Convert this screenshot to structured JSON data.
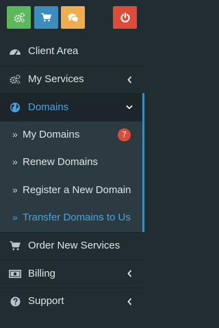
{
  "toolbar": {
    "buttons": [
      {
        "icon": "gears-icon",
        "color": "#5cb85c"
      },
      {
        "icon": "cart-icon",
        "color": "#3c8dbc"
      },
      {
        "icon": "comments-icon",
        "color": "#f0ad4e"
      },
      {
        "icon": "power-icon",
        "color": "#dd4b39"
      }
    ]
  },
  "menu": {
    "client_area": "Client Area",
    "my_services": "My Services",
    "domains": "Domains",
    "domains_sub": {
      "my_domains": "My Domains",
      "my_domains_badge": "7",
      "renew_domains": "Renew Domains",
      "register_domain": "Register a New Domain",
      "transfer_domains": "Transfer Domains to Us"
    },
    "order_services": "Order New Services",
    "billing": "Billing",
    "support": "Support"
  },
  "colors": {
    "sidebar_bg": "#222d32",
    "submenu_bg": "#2c3b41",
    "accent": "#4aa3df",
    "badge": "#dd4b39"
  }
}
